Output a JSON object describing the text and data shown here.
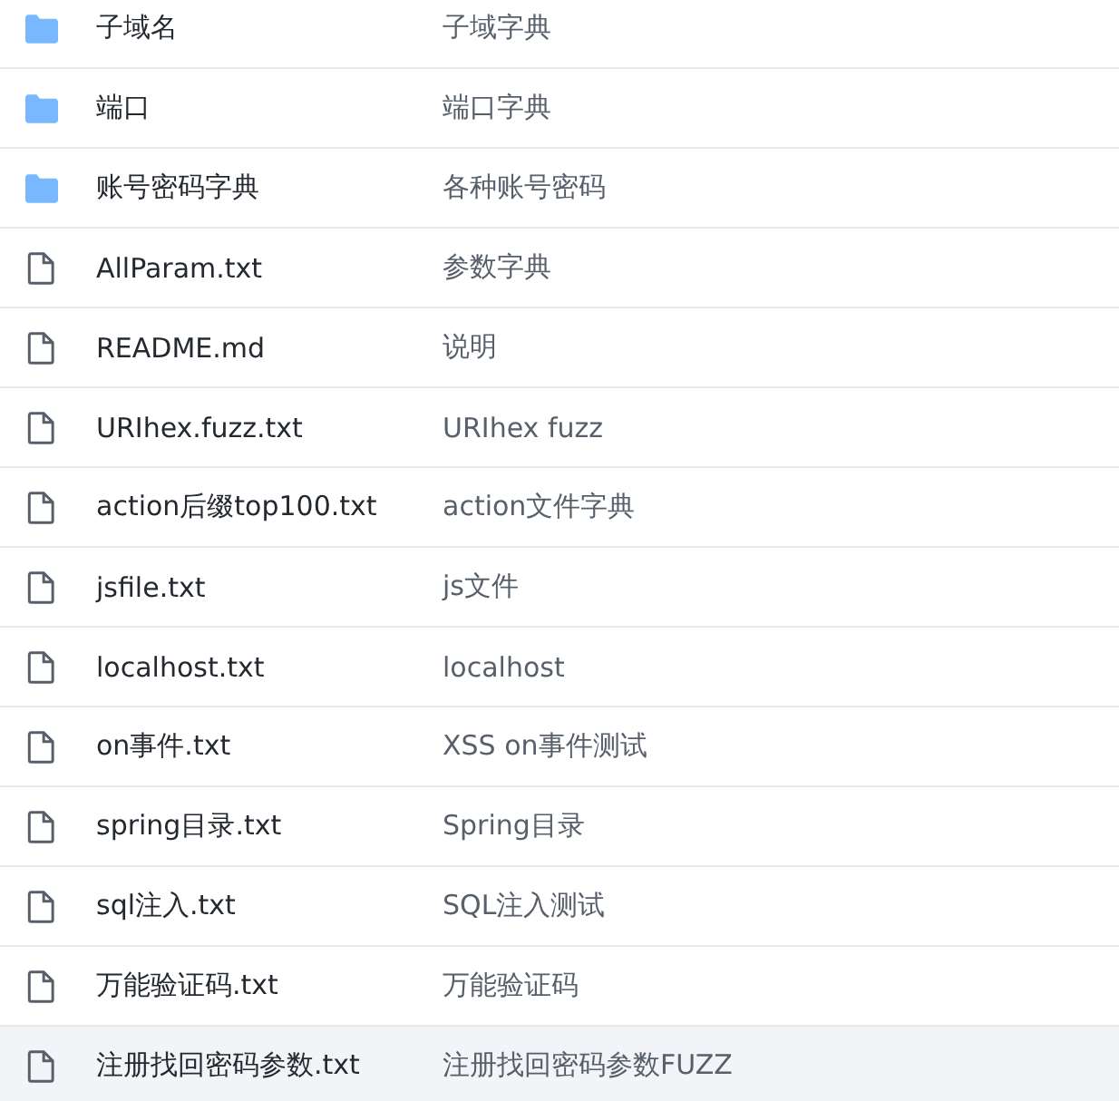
{
  "files": [
    {
      "kind": "folder",
      "name": "子域名",
      "description": "子域字典",
      "highlighted": false
    },
    {
      "kind": "folder",
      "name": "端口",
      "description": "端口字典",
      "highlighted": false
    },
    {
      "kind": "folder",
      "name": "账号密码字典",
      "description": "各种账号密码",
      "highlighted": false
    },
    {
      "kind": "file",
      "name": "AllParam.txt",
      "description": "参数字典",
      "highlighted": false
    },
    {
      "kind": "file",
      "name": "README.md",
      "description": "说明",
      "highlighted": false
    },
    {
      "kind": "file",
      "name": "URIhex.fuzz.txt",
      "description": "URIhex fuzz",
      "highlighted": false
    },
    {
      "kind": "file",
      "name": "action后缀top100.txt",
      "description": "action文件字典",
      "highlighted": false
    },
    {
      "kind": "file",
      "name": "jsfile.txt",
      "description": "js文件",
      "highlighted": false
    },
    {
      "kind": "file",
      "name": "localhost.txt",
      "description": "localhost",
      "highlighted": false
    },
    {
      "kind": "file",
      "name": "on事件.txt",
      "description": "XSS on事件测试",
      "highlighted": false
    },
    {
      "kind": "file",
      "name": "spring目录.txt",
      "description": "Spring目录",
      "highlighted": false
    },
    {
      "kind": "file",
      "name": "sql注入.txt",
      "description": "SQL注入测试",
      "highlighted": false
    },
    {
      "kind": "file",
      "name": "万能验证码.txt",
      "description": "万能验证码",
      "highlighted": false
    },
    {
      "kind": "file",
      "name": "注册找回密码参数.txt",
      "description": "注册找回密码参数FUZZ",
      "highlighted": true
    }
  ]
}
